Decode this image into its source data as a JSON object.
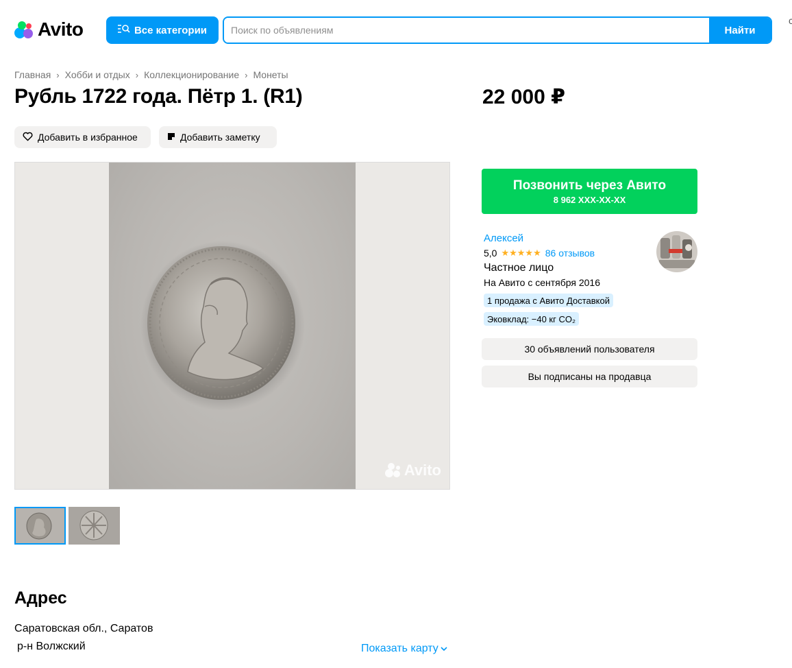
{
  "header": {
    "logo_text": "Avito",
    "categories_label": "Все категории",
    "search_placeholder": "Поиск по объявлениям",
    "search_value": "",
    "search_button": "Найти",
    "edge_glyph": "с"
  },
  "breadcrumbs": [
    {
      "label": "Главная"
    },
    {
      "label": "Хобби и отдых"
    },
    {
      "label": "Коллекционирование"
    },
    {
      "label": "Монеты"
    }
  ],
  "listing": {
    "title": "Рубль 1722 года. Пётр 1. (R1)",
    "price": "22 000 ₽",
    "favorite_label": "Добавить в избранное",
    "note_label": "Добавить заметку",
    "watermark": "Avito",
    "thumbnails": [
      {
        "icon": "coin-portrait-thumb",
        "active": true
      },
      {
        "icon": "coin-reverse-thumb",
        "active": false
      }
    ]
  },
  "seller": {
    "call_label": "Позвонить через Авито",
    "phone": "8 962 XXX-XX-XX",
    "name": "Алексей",
    "rating": "5,0",
    "stars": "★★★★★",
    "reviews": "86 отзывов",
    "type": "Частное лицо",
    "since": "На Авито с сентября 2016",
    "badges": [
      "1 продажа с Авито Доставкой",
      "Эковклад: −40 кг CO₂"
    ],
    "listings_button": "30 объявлений пользователя",
    "subscribe_button": "Вы подписаны на продавца"
  },
  "address": {
    "title": "Адрес",
    "line1": "Саратовская обл., Саратов",
    "line2": "р-н Волжский",
    "map_link": "Показать карту"
  },
  "colors": {
    "accent": "#0099f7",
    "call_green": "#02d15c",
    "star": "#ffb021",
    "badge_bg": "#d9f0ff",
    "button_grey": "#f2f1f0"
  }
}
